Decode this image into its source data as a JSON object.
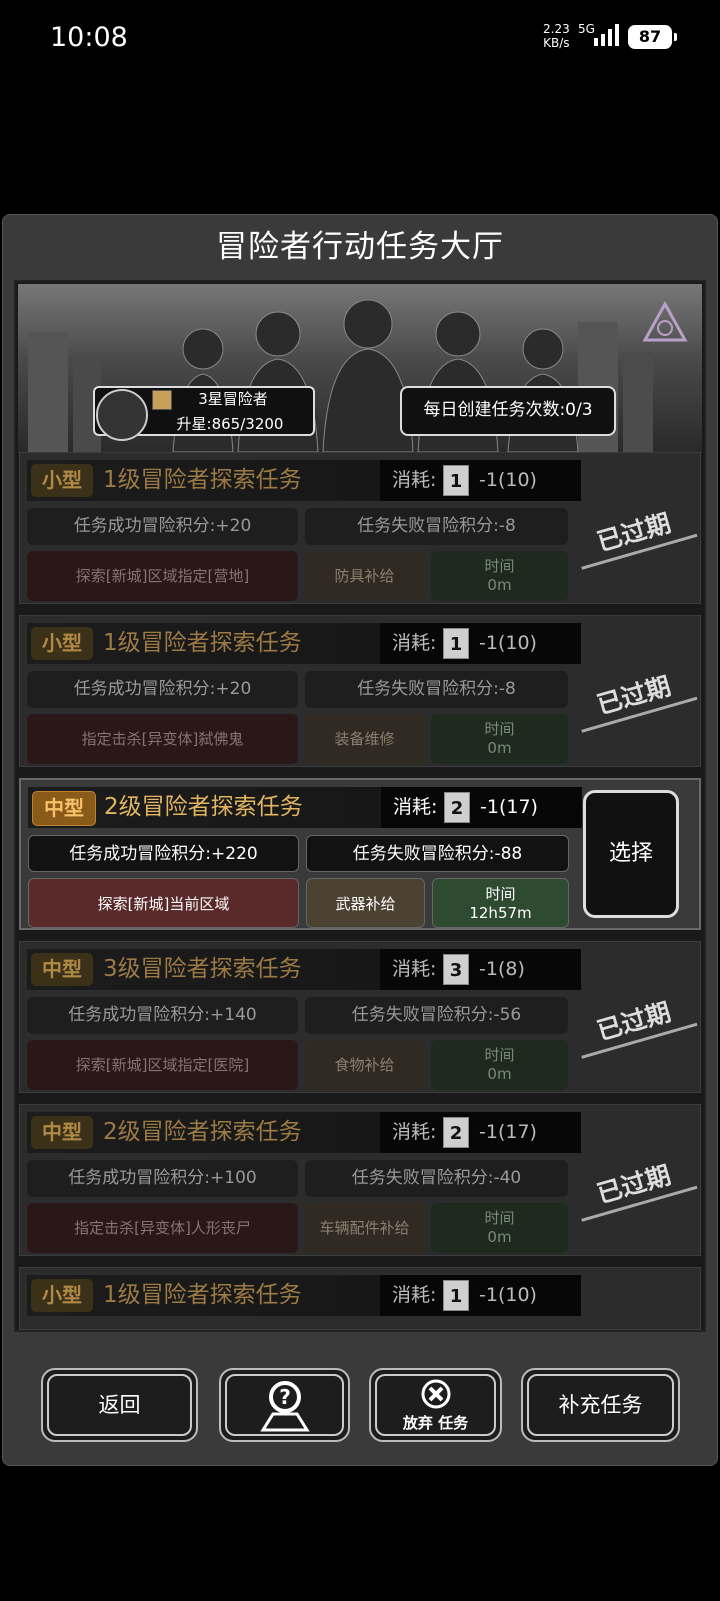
{
  "status_bar": {
    "time": "10:08",
    "speed": "2.23",
    "speed_unit": "KB/s",
    "network": "5G",
    "battery": "87"
  },
  "title": "冒险者行动任务大厅",
  "profile": {
    "rank": "3星冒险者",
    "star_progress": "升星:865/3200"
  },
  "daily_limit": "每日创建任务次数:0/3",
  "tasks": [
    {
      "size": "小型",
      "name": "1级冒险者探索任务",
      "cost_label": "消耗:",
      "level": "1",
      "cost": "-1(10)",
      "success": "任务成功冒险积分:+20",
      "fail": "任务失败冒险积分:-8",
      "target": "探索[新城]区域指定[营地]",
      "reward": "防具补给",
      "time_label": "时间",
      "time": "0m",
      "status": "已过期"
    },
    {
      "size": "小型",
      "name": "1级冒险者探索任务",
      "cost_label": "消耗:",
      "level": "1",
      "cost": "-1(10)",
      "success": "任务成功冒险积分:+20",
      "fail": "任务失败冒险积分:-8",
      "target": "指定击杀[异变体]弑佛鬼",
      "reward": "装备维修",
      "time_label": "时间",
      "time": "0m",
      "status": "已过期"
    },
    {
      "size": "中型",
      "name": "2级冒险者探索任务",
      "cost_label": "消耗:",
      "level": "2",
      "cost": "-1(17)",
      "success": "任务成功冒险积分:+220",
      "fail": "任务失败冒险积分:-88",
      "target": "探索[新城]当前区域",
      "reward": "武器补给",
      "time_label": "时间",
      "time": "12h57m",
      "action": "选择"
    },
    {
      "size": "中型",
      "name": "3级冒险者探索任务",
      "cost_label": "消耗:",
      "level": "3",
      "cost": "-1(8)",
      "success": "任务成功冒险积分:+140",
      "fail": "任务失败冒险积分:-56",
      "target": "探索[新城]区域指定[医院]",
      "reward": "食物补给",
      "time_label": "时间",
      "time": "0m",
      "status": "已过期"
    },
    {
      "size": "中型",
      "name": "2级冒险者探索任务",
      "cost_label": "消耗:",
      "level": "2",
      "cost": "-1(17)",
      "success": "任务成功冒险积分:+100",
      "fail": "任务失败冒险积分:-40",
      "target": "指定击杀[异变体]人形丧尸",
      "reward": "车辆配件补给",
      "time_label": "时间",
      "time": "0m",
      "status": "已过期"
    },
    {
      "size": "小型",
      "name": "1级冒险者探索任务",
      "cost_label": "消耗:",
      "level": "1",
      "cost": "-1(10)"
    }
  ],
  "buttons": {
    "back": "返回",
    "help_icon": "question-map-icon",
    "abandon_icon": "close-circle-icon",
    "abandon": "放弃 任务",
    "add": "补充任务"
  },
  "colors": {
    "panel": "#3a3a3a",
    "accent_gold": "#e2b560",
    "active_target": "#5a2a2a",
    "active_time": "#2e4a30"
  }
}
